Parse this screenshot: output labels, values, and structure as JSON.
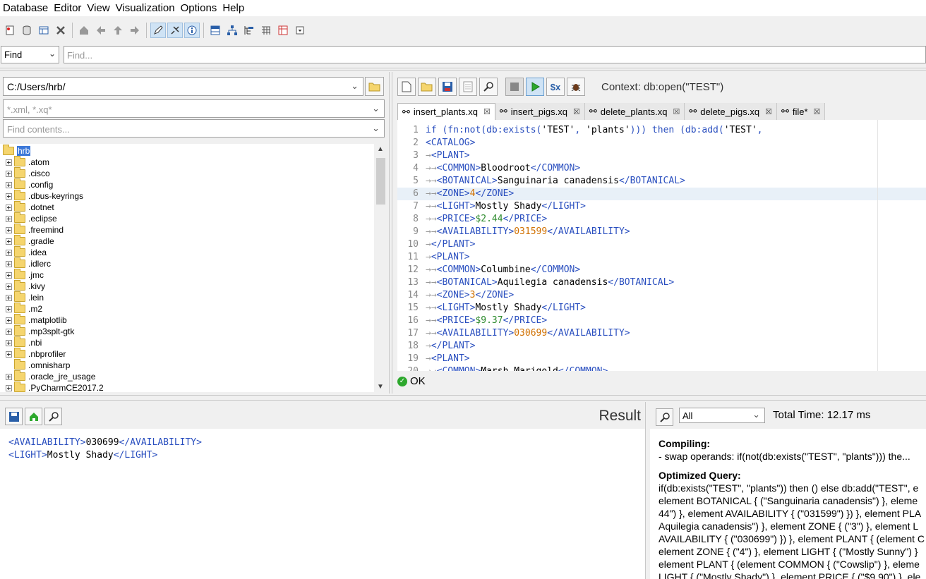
{
  "menu": [
    "Database",
    "Editor",
    "View",
    "Visualization",
    "Options",
    "Help"
  ],
  "find": {
    "mode": "Find",
    "placeholder": "Find..."
  },
  "left": {
    "path": "C:/Users/hrb/",
    "filter_placeholder": "*.xml, *.xq*",
    "contents_placeholder": "Find contents...",
    "root": "hrb",
    "items": [
      ".atom",
      ".cisco",
      ".config",
      ".dbus-keyrings",
      ".dotnet",
      ".eclipse",
      ".freemind",
      ".gradle",
      ".idea",
      ".idlerc",
      ".jmc",
      ".kivy",
      ".lein",
      ".m2",
      ".matplotlib",
      ".mp3splt-gtk",
      ".nbi",
      ".nbprofiler",
      ".omnisharp",
      ".oracle_jre_usage",
      ".PyCharmCE2017.2"
    ]
  },
  "editor": {
    "context": "Context: db:open(\"TEST\")",
    "tabs": [
      {
        "label": "insert_plants.xq",
        "active": true
      },
      {
        "label": "insert_pigs.xq",
        "active": false
      },
      {
        "label": "delete_plants.xq",
        "active": false
      },
      {
        "label": "delete_pigs.xq",
        "active": false
      },
      {
        "label": "file*",
        "active": false
      }
    ],
    "lines": [
      "if (fn:not(db:exists('TEST', 'plants'))) then (db:add('TEST',",
      "<CATALOG>",
      "→<PLANT>",
      "→→<COMMON>Bloodroot</COMMON>",
      "→→<BOTANICAL>Sanguinaria canadensis</BOTANICAL>",
      "→→<ZONE>4</ZONE>",
      "→→<LIGHT>Mostly Shady</LIGHT>",
      "→→<PRICE>$2.44</PRICE>",
      "→→<AVAILABILITY>031599</AVAILABILITY>",
      "→</PLANT>",
      "→<PLANT>",
      "→→<COMMON>Columbine</COMMON>",
      "→→<BOTANICAL>Aquilegia canadensis</BOTANICAL>",
      "→→<ZONE>3</ZONE>",
      "→→<LIGHT>Mostly Shady</LIGHT>",
      "→→<PRICE>$9.37</PRICE>",
      "→→<AVAILABILITY>030699</AVAILABILITY>",
      "→</PLANT>",
      "→<PLANT>",
      "→→<COMMON>Marsh Marigold</COMMON>"
    ],
    "highlight_line": 6,
    "status": "OK"
  },
  "result": {
    "title": "Result",
    "lines": [
      "<AVAILABILITY>030699</AVAILABILITY>",
      "<LIGHT>Mostly Shady</LIGHT>"
    ]
  },
  "info": {
    "filter": "All",
    "total_time": "Total Time: 12.17 ms",
    "compiling_label": "Compiling:",
    "compiling_text": "- swap operands: if(not(db:exists(\"TEST\", \"plants\"))) the...",
    "optimized_label": "Optimized Query:",
    "optimized_lines": [
      "if(db:exists(\"TEST\", \"plants\")) then () else db:add(\"TEST\", e",
      "element BOTANICAL { (\"Sanguinaria canadensis\") }, eleme",
      "44\") }, element AVAILABILITY { (\"031599\") }) }, element PLA",
      "Aquilegia canadensis\") }, element ZONE { (\"3\") }, element L",
      "AVAILABILITY { (\"030699\") }) }, element PLANT { (element C",
      "element ZONE { (\"4\") }, element LIGHT { (\"Mostly Sunny\") }",
      "element PLANT { (element COMMON { (\"Cowslip\") }, eleme",
      "LIGHT { (\"Mostly Shady\") }, element PRICE { (\"$9.90\") }, ele"
    ]
  }
}
